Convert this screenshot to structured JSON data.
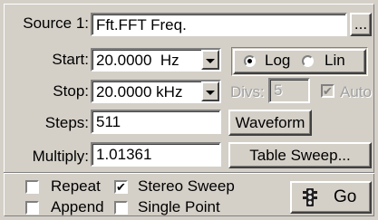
{
  "source": {
    "label": "Source 1:",
    "value": "Fft.FFT Freq.",
    "browse_label": "..."
  },
  "start": {
    "label": "Start:",
    "value": "20.0000  Hz"
  },
  "stop": {
    "label": "Stop:",
    "value": "20.0000 kHz"
  },
  "scale": {
    "log_label": "Log",
    "lin_label": "Lin",
    "selected": "Log"
  },
  "divs": {
    "label": "Divs:",
    "value": "5"
  },
  "auto": {
    "label": "Auto",
    "checked": true,
    "check_mark": "✔"
  },
  "steps": {
    "label": "Steps:",
    "value": "511"
  },
  "multiply": {
    "label": "Multiply:",
    "value": "1.01361"
  },
  "buttons": {
    "waveform": "Waveform",
    "table_sweep": "Table Sweep...",
    "go": "Go"
  },
  "options": {
    "repeat": {
      "label": "Repeat",
      "checked": false
    },
    "stereo_sweep": {
      "label": "Stereo Sweep",
      "checked": true,
      "check_mark": "✔"
    },
    "append": {
      "label": "Append",
      "checked": false
    },
    "single_point": {
      "label": "Single Point",
      "checked": false
    }
  },
  "icons": {
    "go": "traffic-light-icon",
    "dropdown": "chevron-down-icon"
  }
}
